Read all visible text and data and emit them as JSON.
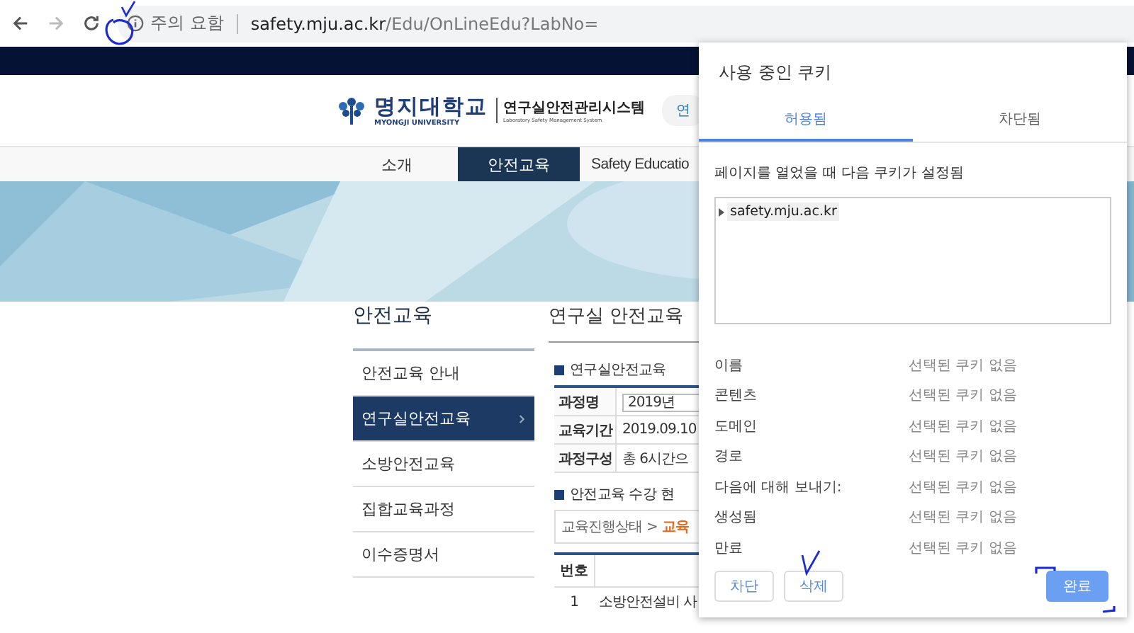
{
  "browser": {
    "security_label": "주의 요함",
    "url_host": "safety.mju.ac.kr",
    "url_path": "/Edu/OnLineEdu?LabNo="
  },
  "header": {
    "logo_korean": "명지대학교",
    "logo_english": "MYONGJI UNIVERSITY",
    "system_title": "연구실안전관리시스템",
    "system_subtitle": "Laboratory Safety Management System",
    "header_link": "연"
  },
  "nav": [
    {
      "label": "소개",
      "selected": false
    },
    {
      "label": "안전교육",
      "selected": true
    },
    {
      "label": "Safety Educatio",
      "selected": false
    }
  ],
  "sidebar": {
    "title": "안전교육",
    "items": [
      {
        "label": "안전교육 안내",
        "selected": false
      },
      {
        "label": "연구실안전교육",
        "selected": true
      },
      {
        "label": "소방안전교육",
        "selected": false
      },
      {
        "label": "집합교육과정",
        "selected": false
      },
      {
        "label": "이수증명서",
        "selected": false
      }
    ]
  },
  "main": {
    "title": "연구실 안전교육",
    "section_1": "연구실안전교육",
    "info_rows": [
      {
        "label": "과정명",
        "value": "2019년",
        "kind": "field"
      },
      {
        "label": "교육기간",
        "value": "2019.09.10",
        "kind": "text"
      },
      {
        "label": "과정구성",
        "value": "총 6시간으",
        "kind": "text"
      }
    ],
    "section_2": "안전교육 수강 현",
    "breadcrumb": {
      "separator": ">",
      "items": [
        {
          "label": "교육진행상태",
          "selected": false
        },
        {
          "label": "교육",
          "selected": true
        }
      ]
    },
    "table": {
      "columns": [
        "번호"
      ],
      "rows": [
        [
          "1",
          "소방안전설비 사"
        ]
      ]
    }
  },
  "popup": {
    "title": "사용 중인 쿠키",
    "tabs": [
      {
        "label": "허용됨",
        "selected": true
      },
      {
        "label": "차단됨",
        "selected": false
      }
    ],
    "description": "페이지를 열었을 때 다음 쿠키가 설정됨",
    "tree": [
      {
        "label": "safety.mju.ac.kr",
        "expanded": false
      }
    ],
    "details": [
      {
        "label": "이름",
        "value": "선택된 쿠키 없음"
      },
      {
        "label": "콘텐츠",
        "value": "선택된 쿠키 없음"
      },
      {
        "label": "도메인",
        "value": "선택된 쿠키 없음"
      },
      {
        "label": "경로",
        "value": "선택된 쿠키 없음"
      },
      {
        "label": "다음에 대해 보내기:",
        "value": "선택된 쿠키 없음"
      },
      {
        "label": "생성됨",
        "value": "선택된 쿠키 없음"
      },
      {
        "label": "만료",
        "value": "선택된 쿠키 없음"
      }
    ],
    "buttons": [
      {
        "label": "차단",
        "kind": "secondary"
      },
      {
        "label": "삭제",
        "kind": "secondary"
      },
      {
        "label": "완료",
        "kind": "primary"
      }
    ]
  }
}
